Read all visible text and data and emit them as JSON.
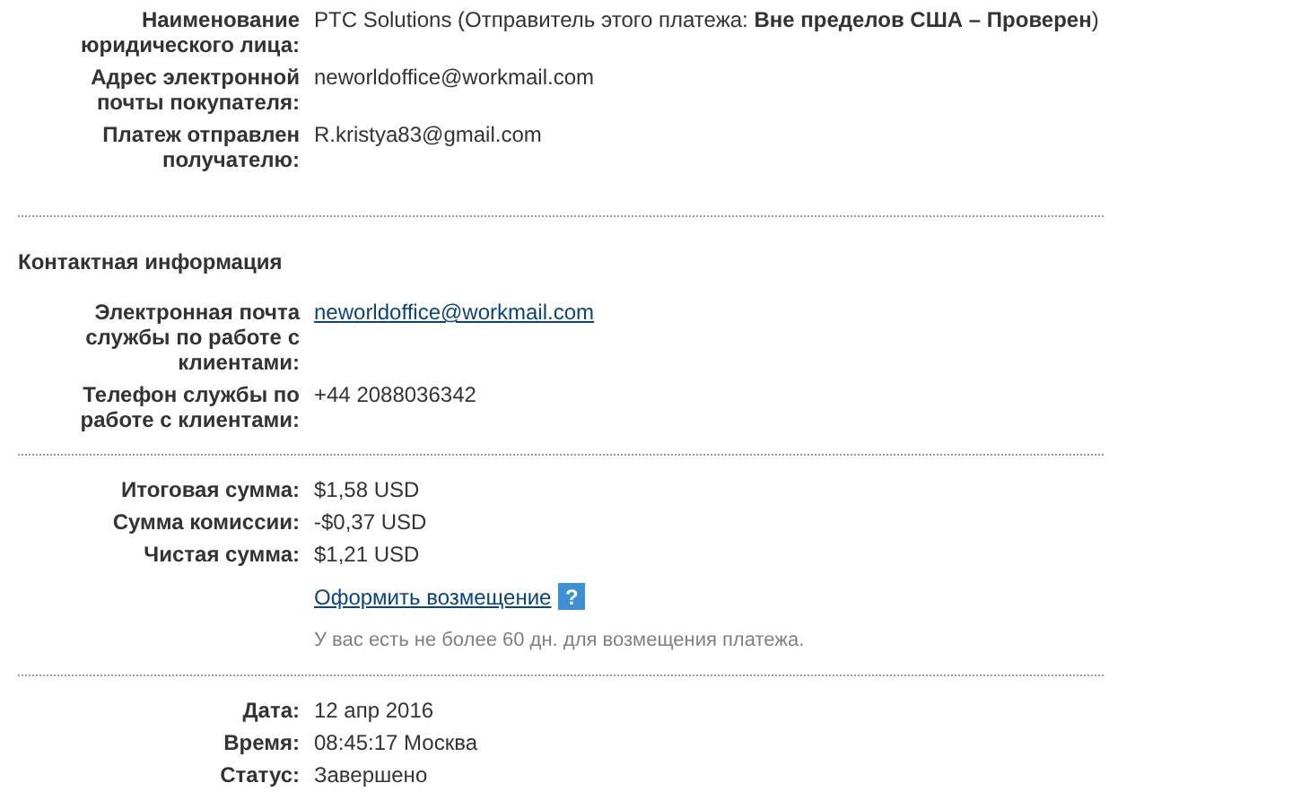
{
  "sections": [
    {
      "rows": [
        {
          "kind": "text",
          "label": "Наименование юридического лица:",
          "value": "PTC Solutions (Отправитель этого платежа: **Вне пределов США – Проверен**)"
        },
        {
          "kind": "text",
          "label": "Адрес электронной почты покупателя:",
          "value": "neworldoffice@workmail.com"
        },
        {
          "kind": "text",
          "label": "Платеж отправлен получателю:",
          "value": "R.kristya83@gmail.com"
        }
      ]
    },
    {
      "heading": "Контактная информация",
      "rows": [
        {
          "kind": "link",
          "label": "Электронная почта службы по работе с клиентами:",
          "value": "neworldoffice@workmail.com"
        },
        {
          "kind": "text",
          "label": "Телефон службы по работе с клиентами:",
          "value": "+44 2088036342"
        }
      ]
    },
    {
      "rows": [
        {
          "kind": "text",
          "label": "Итоговая сумма:",
          "value": "$1,58 USD"
        },
        {
          "kind": "text",
          "label": "Сумма комиссии:",
          "value": "-$0,37 USD"
        },
        {
          "kind": "text",
          "label": "Чистая сумма:",
          "value": "$1,21 USD"
        },
        {
          "kind": "help-link",
          "value": "Оформить возмещение",
          "help": "?"
        },
        {
          "kind": "note",
          "value": "У вас есть не более 60 дн. для возмещения платежа."
        }
      ]
    },
    {
      "rows": [
        {
          "kind": "text",
          "label": "Дата:",
          "value": "12 апр 2016"
        },
        {
          "kind": "text",
          "label": "Время:",
          "value": "08:45:17 Москва"
        },
        {
          "kind": "text",
          "label": "Статус:",
          "value": "Завершено"
        }
      ]
    }
  ]
}
